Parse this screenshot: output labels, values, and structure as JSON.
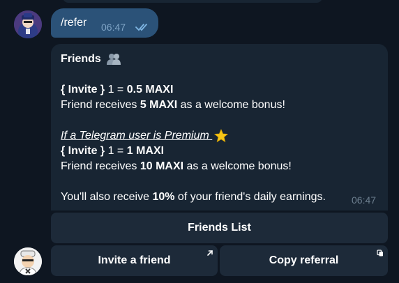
{
  "outgoing": {
    "text": "/refer",
    "time": "06:47",
    "status_icon": "double-check-icon"
  },
  "incoming": {
    "title": "Friends",
    "title_emoji": "busts-in-silhouette-icon",
    "invite_tag_1": "{ Invite }",
    "invite_ratio_1_prefix": " 1 = ",
    "invite_reward_1": "0.5 MAXI",
    "friend_receives_1_prefix": "Friend receives ",
    "friend_bonus_1": "5 MAXI",
    "friend_receives_1_suffix": " as a welcome bonus!",
    "premium_link": "If a Telegram user is Premium ",
    "premium_emoji": "star-icon",
    "invite_tag_2": "{ Invite }",
    "invite_ratio_2_prefix": " 1 = ",
    "invite_reward_2": "1 MAXI",
    "friend_receives_2_prefix": "Friend receives ",
    "friend_bonus_2": "10 MAXI",
    "friend_receives_2_suffix": " as a welcome bonus!",
    "earnings_prefix": "You'll also receive ",
    "earnings_percent": "10%",
    "earnings_suffix": " of your friend's daily earnings.",
    "time": "06:47"
  },
  "keyboard": {
    "friends_list": "Friends List",
    "invite_friend": "Invite a friend",
    "copy_referral": "Copy referral"
  },
  "colors": {
    "background": "#0e1621",
    "outgoing_bubble": "#2b5278",
    "incoming_bubble": "#182533",
    "keyboard_button": "#1d2a39"
  }
}
